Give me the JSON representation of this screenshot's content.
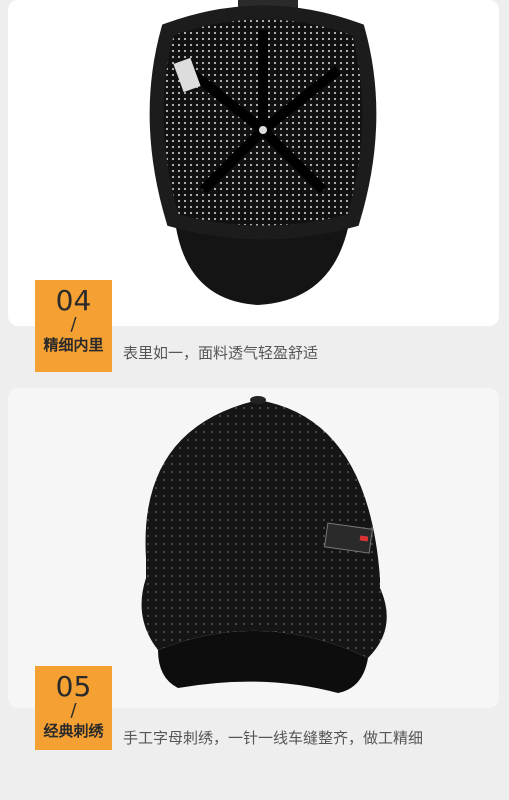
{
  "sections": [
    {
      "number": "04",
      "slash": "/",
      "title": "精细内里",
      "caption": "表里如一，面料透气轻盈舒适"
    },
    {
      "number": "05",
      "slash": "/",
      "title": "经典刺绣",
      "caption": "手工字母刺绣，一针一线车缝整齐，做工精细"
    }
  ],
  "colors": {
    "badge": "#f5a033",
    "cap": "#151515",
    "background": "#eeeeee"
  }
}
